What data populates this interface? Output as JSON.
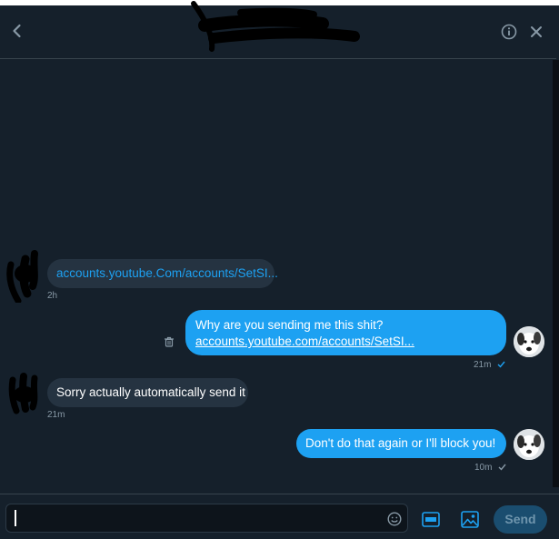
{
  "conversation": {
    "title": ""
  },
  "messages": [
    {
      "direction": "incoming",
      "text": "",
      "link": "accounts.youtube.Com/accounts/SetSI...",
      "time": "2h"
    },
    {
      "direction": "outgoing",
      "text": "Why are you sending me this shit?",
      "link": "accounts.youtube.com/accounts/SetSI...",
      "time": "21m"
    },
    {
      "direction": "incoming",
      "text": "Sorry actually automatically send it",
      "time": "21m"
    },
    {
      "direction": "outgoing",
      "text": "Don't do that again or I'll block you!",
      "time": "10m"
    }
  ],
  "composer": {
    "value": "",
    "send_label": "Send",
    "gif_label": "GIF"
  },
  "colors": {
    "background": "#15202b",
    "bubble_incoming": "#253341",
    "bubble_outgoing": "#1da1f2",
    "link": "#1da1f2",
    "muted": "#8899a6",
    "send_disabled": "#1a4d6f"
  },
  "icons": {
    "back": "chevron-left-icon",
    "info": "info-icon",
    "close": "close-icon",
    "delete": "trash-icon",
    "emoji": "emoji-icon",
    "gif": "gif-icon",
    "image": "image-icon",
    "read": "checkmark-icon"
  }
}
